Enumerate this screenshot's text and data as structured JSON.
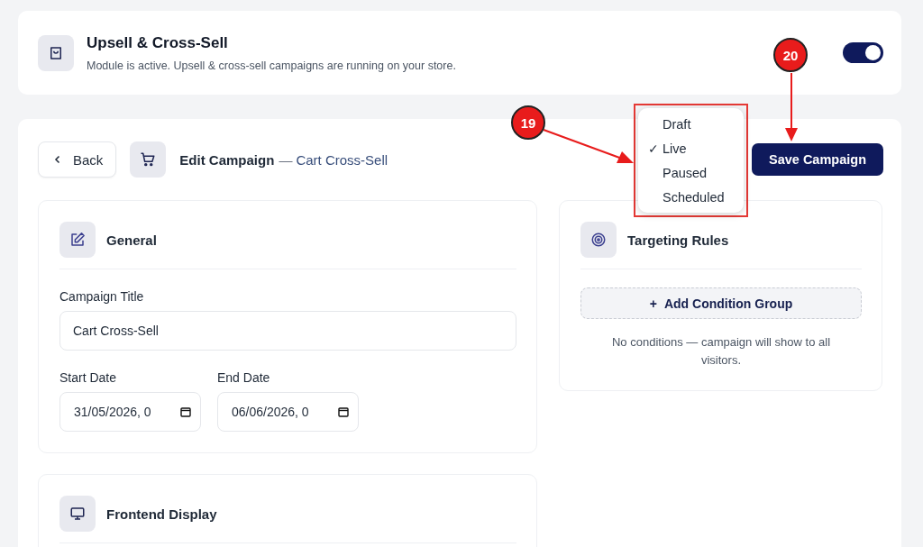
{
  "module": {
    "title": "Upsell & Cross-Sell",
    "subtitle": "Module is active. Upsell & cross-sell campaigns are running on your store.",
    "on": true
  },
  "header": {
    "back": "Back",
    "title": "Edit Campaign",
    "separator": "—",
    "campaign": "Cart Cross-Sell",
    "save": "Save Campaign"
  },
  "status_menu": [
    {
      "label": "Draft",
      "selected": false
    },
    {
      "label": "Live",
      "selected": true
    },
    {
      "label": "Paused",
      "selected": false
    },
    {
      "label": "Scheduled",
      "selected": false
    }
  ],
  "check_mark": "✓",
  "general": {
    "title": "General",
    "title_label": "Campaign Title",
    "title_value": "Cart Cross-Sell",
    "start_label": "Start Date",
    "start_value": "31/05/2026, 0",
    "end_label": "End Date",
    "end_value": "06/06/2026, 0"
  },
  "targeting": {
    "title": "Targeting Rules",
    "add_button": "Add Condition Group",
    "plus": "+",
    "note": "No conditions — campaign will show to all visitors."
  },
  "frontend": {
    "title": "Frontend Display"
  },
  "callouts": [
    {
      "label": "19"
    },
    {
      "label": "20"
    }
  ]
}
